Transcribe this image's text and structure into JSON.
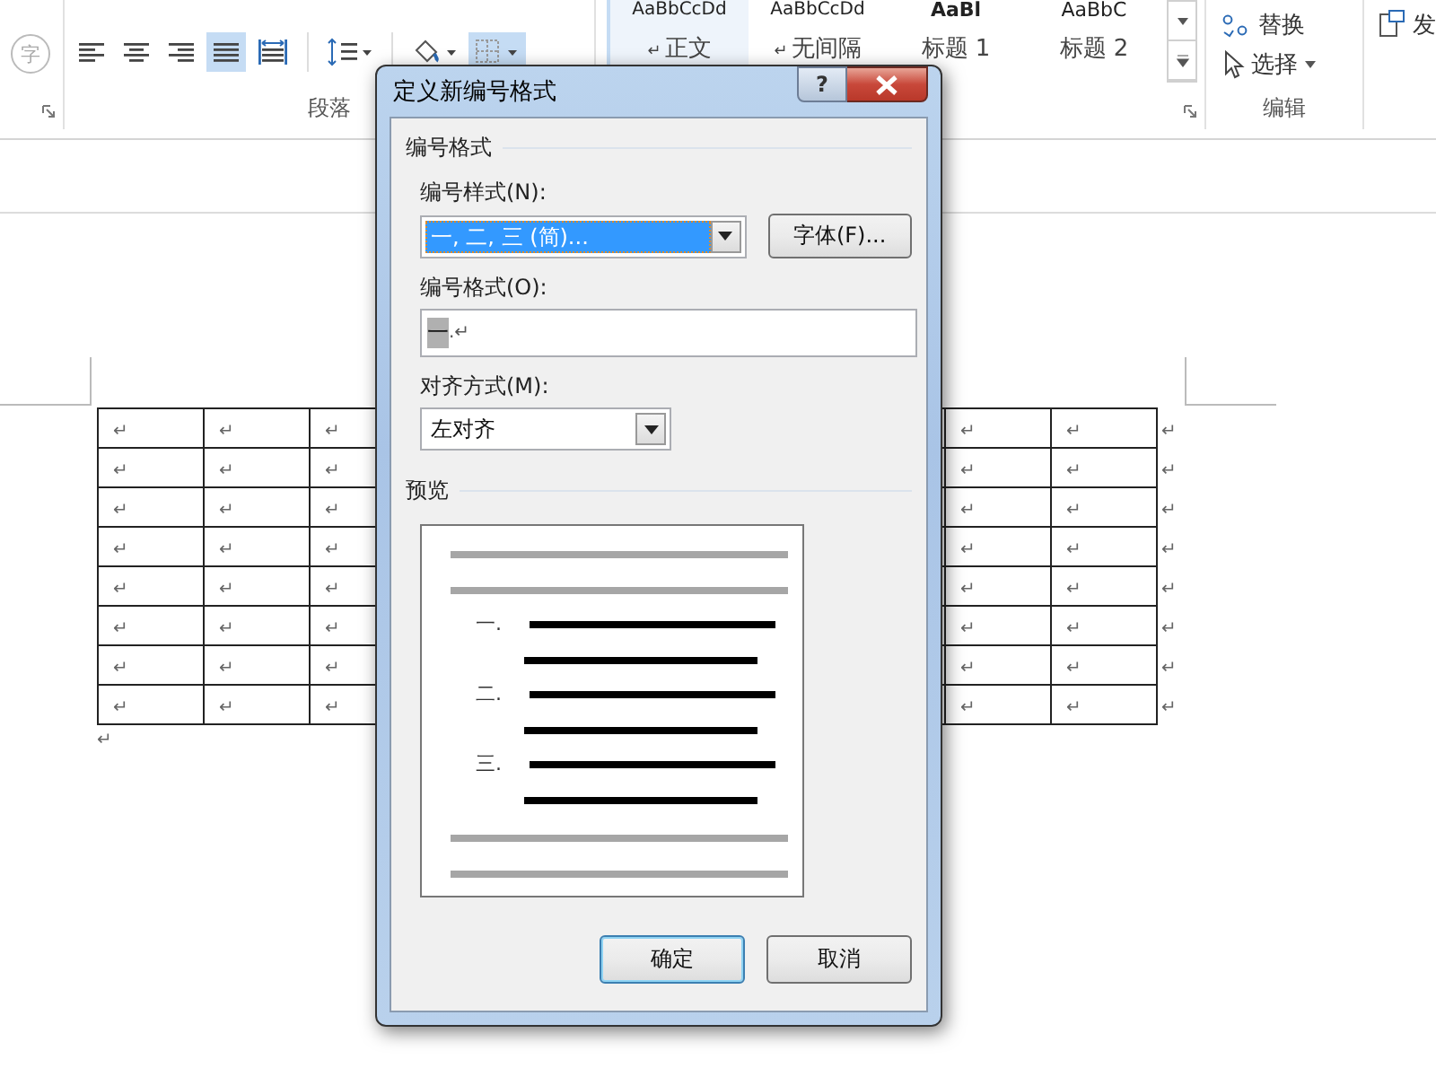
{
  "ribbon": {
    "font_group": {
      "tools": [
        {
          "kind": "phonetic",
          "label": "字",
          "disabled": true
        }
      ]
    },
    "paragraph_group": {
      "label": "段落",
      "tools": [
        {
          "kind": "align-left",
          "selected": false
        },
        {
          "kind": "align-center",
          "selected": false
        },
        {
          "kind": "align-right",
          "selected": false
        },
        {
          "kind": "justify",
          "selected": true
        },
        {
          "kind": "distribute",
          "selected": false
        },
        {
          "kind": "line-spacing",
          "selected": false
        },
        {
          "kind": "shading",
          "selected": false
        },
        {
          "kind": "borders",
          "selected": true
        }
      ]
    },
    "styles_group": {
      "styles": [
        {
          "sample": "AaBbCcDd",
          "name": "正文",
          "mark": "↵",
          "selected": true
        },
        {
          "sample": "AaBbCcDd",
          "name": "无间隔",
          "mark": "↵",
          "selected": false
        },
        {
          "sample": "AaBl",
          "name": "标题 1",
          "selected": false
        },
        {
          "sample": "AaBbC",
          "name": "标题 2",
          "selected": false
        }
      ]
    },
    "editing_group": {
      "label": "编辑",
      "tools": [
        {
          "kind": "replace",
          "label": "替换"
        },
        {
          "kind": "select",
          "label": "选择"
        }
      ]
    },
    "cut_group": {
      "label": "发"
    }
  },
  "document": {
    "rows": [
      {
        "left": [
          "↵",
          "↵",
          "↵"
        ],
        "right": [
          "↵",
          "↵"
        ],
        "end": "↵"
      },
      {
        "left": [
          "↵",
          "↵",
          "↵"
        ],
        "right": [
          "↵",
          "↵"
        ],
        "end": "↵"
      },
      {
        "left": [
          "↵",
          "↵",
          "↵"
        ],
        "right": [
          "↵",
          "↵"
        ],
        "end": "↵"
      },
      {
        "left": [
          "↵",
          "↵",
          "↵"
        ],
        "right": [
          "↵",
          "↵"
        ],
        "end": "↵"
      },
      {
        "left": [
          "↵",
          "↵",
          "↵"
        ],
        "right": [
          "↵",
          "↵"
        ],
        "end": "↵"
      },
      {
        "left": [
          "↵",
          "↵",
          "↵"
        ],
        "right": [
          "↵",
          "↵"
        ],
        "end": "↵"
      },
      {
        "left": [
          "↵",
          "↵",
          "↵"
        ],
        "right": [
          "↵",
          "↵"
        ],
        "end": "↵"
      },
      {
        "left": [
          "↵",
          "↵",
          "↵"
        ],
        "right": [
          "↵",
          "↵"
        ],
        "end": "↵"
      }
    ],
    "after_mark": "↵"
  },
  "dialog": {
    "title": "定义新编号格式",
    "help": "?",
    "group": "编号格式",
    "style_label": "编号样式(N):",
    "style_value": "一, 二, 三 (简)...",
    "font_button": "字体(F)...",
    "format_label": "编号格式(O):",
    "format_number": "一",
    "format_rest": ".↵",
    "align_label": "对齐方式(M):",
    "align_value": "左对齐",
    "preview_label": "预览",
    "preview_numbers": [
      "一.",
      "二.",
      "三."
    ],
    "buttons": [
      {
        "label": "确定",
        "default": true
      },
      {
        "label": "取消",
        "default": false
      }
    ]
  }
}
